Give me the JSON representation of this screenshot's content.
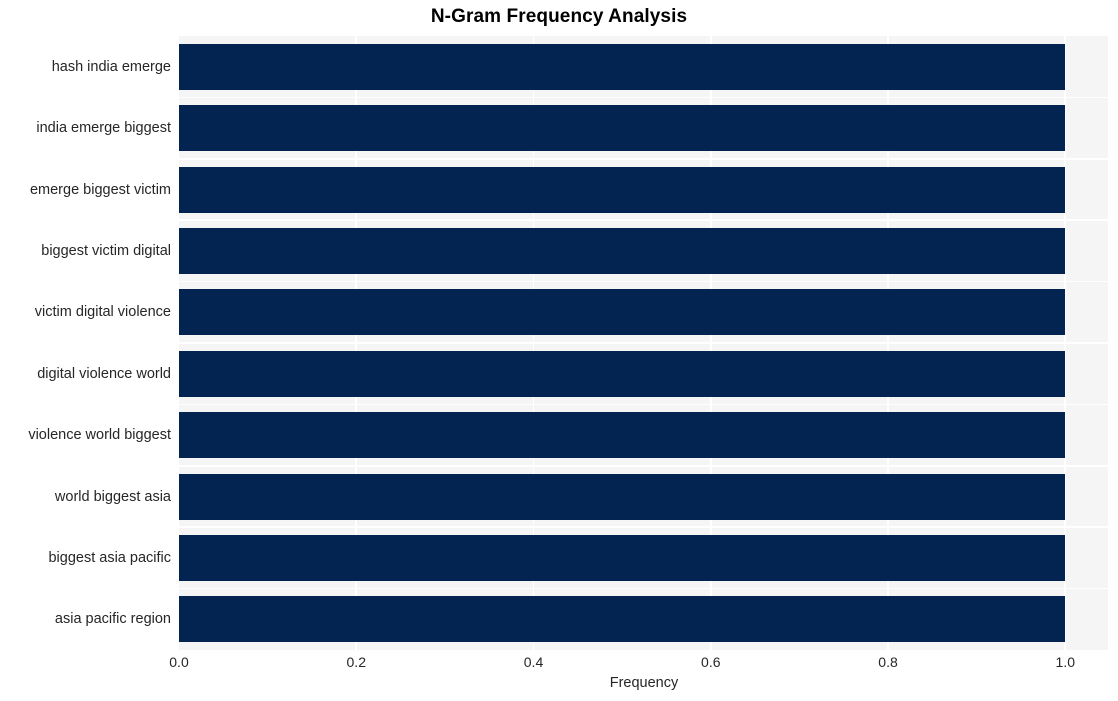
{
  "chart_data": {
    "type": "bar",
    "orientation": "horizontal",
    "title": "N-Gram Frequency Analysis",
    "xlabel": "Frequency",
    "ylabel": "",
    "categories": [
      "hash india emerge",
      "india emerge biggest",
      "emerge biggest victim",
      "biggest victim digital",
      "victim digital violence",
      "digital violence world",
      "violence world biggest",
      "world biggest asia",
      "biggest asia pacific",
      "asia pacific region"
    ],
    "values": [
      1.0,
      1.0,
      1.0,
      1.0,
      1.0,
      1.0,
      1.0,
      1.0,
      1.0,
      1.0
    ],
    "xlim": [
      0.0,
      1.0482
    ],
    "xticks": [
      0.0,
      0.2,
      0.4,
      0.6,
      0.8,
      1.0
    ],
    "xtick_labels": [
      "0.0",
      "0.2",
      "0.4",
      "0.6",
      "0.8",
      "1.0"
    ],
    "grid": true,
    "grid_color": "#ffffff",
    "legend": null,
    "bar_color": "#032351",
    "plot_background": "#f5f5f6",
    "figure_background": "#ffffff",
    "text_color": "#262626",
    "title_color": "#000000"
  }
}
